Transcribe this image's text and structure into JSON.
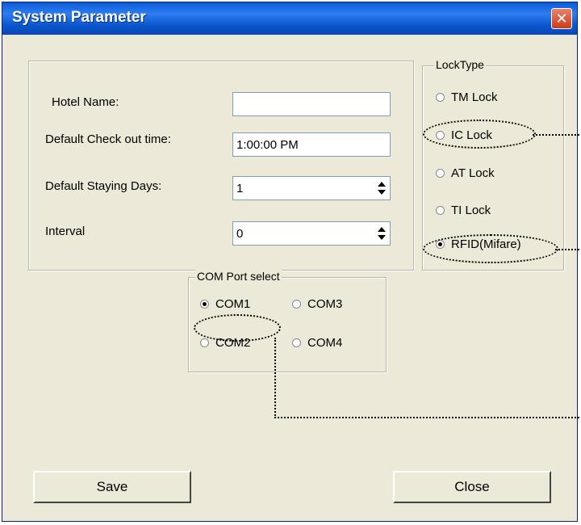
{
  "window": {
    "title": "System Parameter",
    "close_glyph": "✕"
  },
  "settings": {
    "hotel_name_label": "Hotel Name:",
    "hotel_name_value": "",
    "checkout_label": "Default Check out time:",
    "checkout_value": "1:00:00 PM",
    "staying_days_label": "Default Staying Days:",
    "staying_days_value": "1",
    "interval_label": "Interval",
    "interval_value": "0"
  },
  "lock_type": {
    "legend": "LockType",
    "options": [
      {
        "label": "TM Lock",
        "selected": false
      },
      {
        "label": "IC Lock",
        "selected": false
      },
      {
        "label": "AT Lock",
        "selected": false
      },
      {
        "label": "TI Lock",
        "selected": false
      },
      {
        "label": "RFID(Mifare)",
        "selected": true
      }
    ]
  },
  "com_port": {
    "legend": "COM Port select",
    "options": [
      {
        "label": "COM1",
        "selected": true
      },
      {
        "label": "COM3",
        "selected": false
      },
      {
        "label": "COM2",
        "selected": false
      },
      {
        "label": "COM4",
        "selected": false
      }
    ]
  },
  "buttons": {
    "save": "Save",
    "close": "Close"
  },
  "colors": {
    "titlebar": "#0a5bd6",
    "dialog_bg": "#ece9d8",
    "close_button": "#cc3a1a"
  }
}
